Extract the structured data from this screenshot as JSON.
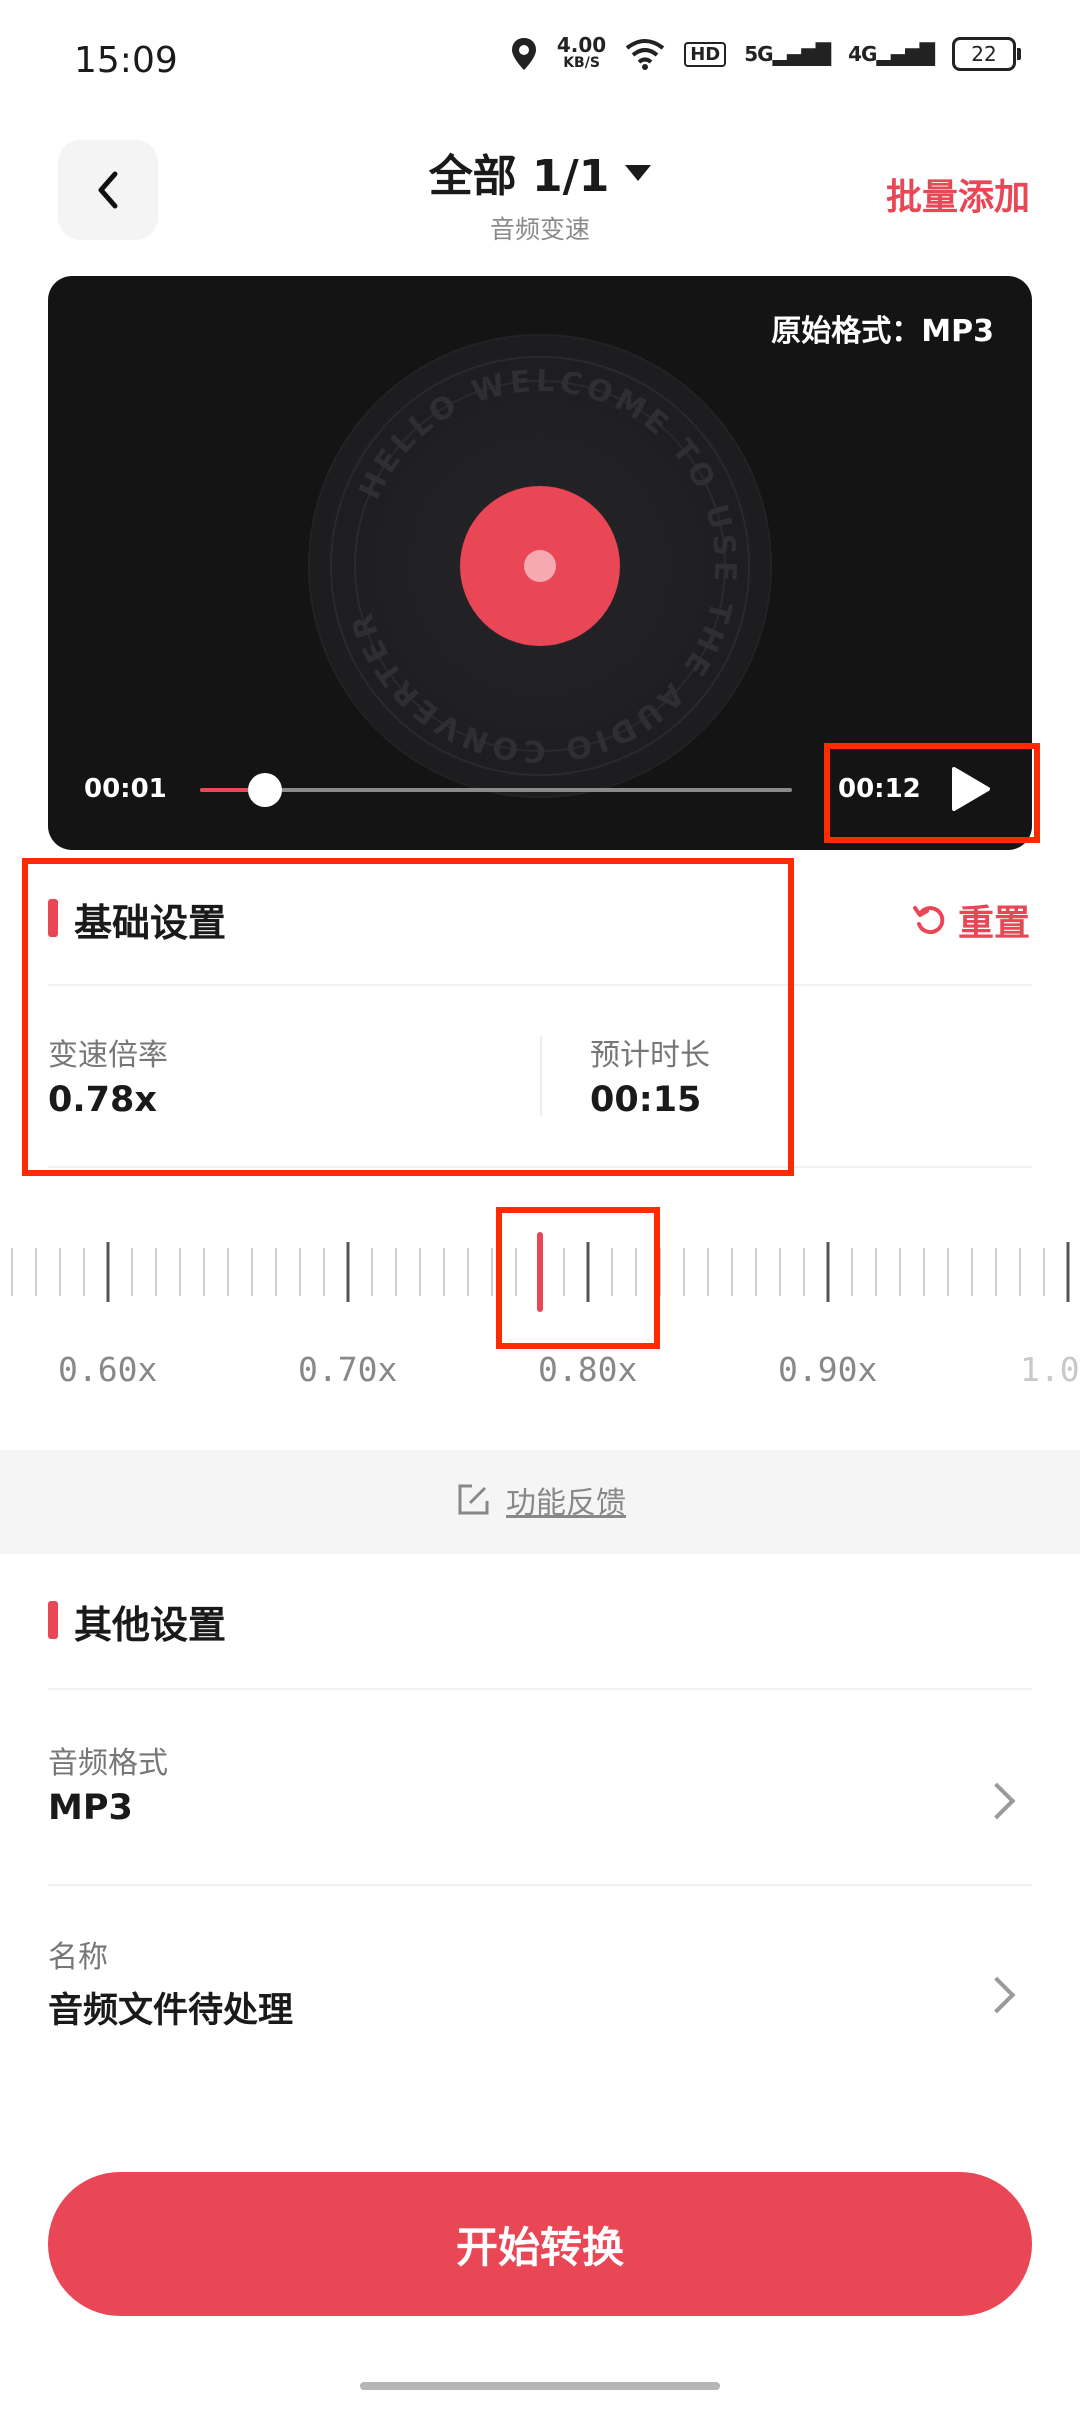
{
  "status_bar": {
    "time": "15:09",
    "net_speed_top": "4.00",
    "net_speed_bottom": "KB/S",
    "hd": "HD",
    "sig1": "5G",
    "sig2": "4G",
    "battery": "22"
  },
  "header": {
    "title": "全部 1/1",
    "subtitle": "音频变速",
    "batch_add": "批量添加"
  },
  "player": {
    "original_format": "原始格式：MP3",
    "disc_text": "HELLO WELCOME TO USE THE AUDIO CONVERTER",
    "current_time": "00:01",
    "total_time": "00:12",
    "progress": 0.11
  },
  "basic_settings": {
    "title": "基础设置",
    "reset": "重置",
    "speed_label": "变速倍率",
    "speed_value": "0.78x",
    "duration_label": "预计时长",
    "duration_value": "00:15"
  },
  "ruler": {
    "labels": [
      "0.60x",
      "0.70x",
      "0.80x",
      "0.90x",
      "1.0"
    ],
    "selected": 0.78,
    "accent": "#e94656"
  },
  "feedback": {
    "label": "功能反馈"
  },
  "other_settings": {
    "title": "其他设置",
    "rows": [
      {
        "label": "音频格式",
        "value": "MP3"
      },
      {
        "label": "名称",
        "value": "音频文件待处理"
      }
    ]
  },
  "start_button": "开始转换",
  "colors": {
    "accent": "#e94656",
    "player_bg": "#141414",
    "annotation": "#ff2a00"
  }
}
